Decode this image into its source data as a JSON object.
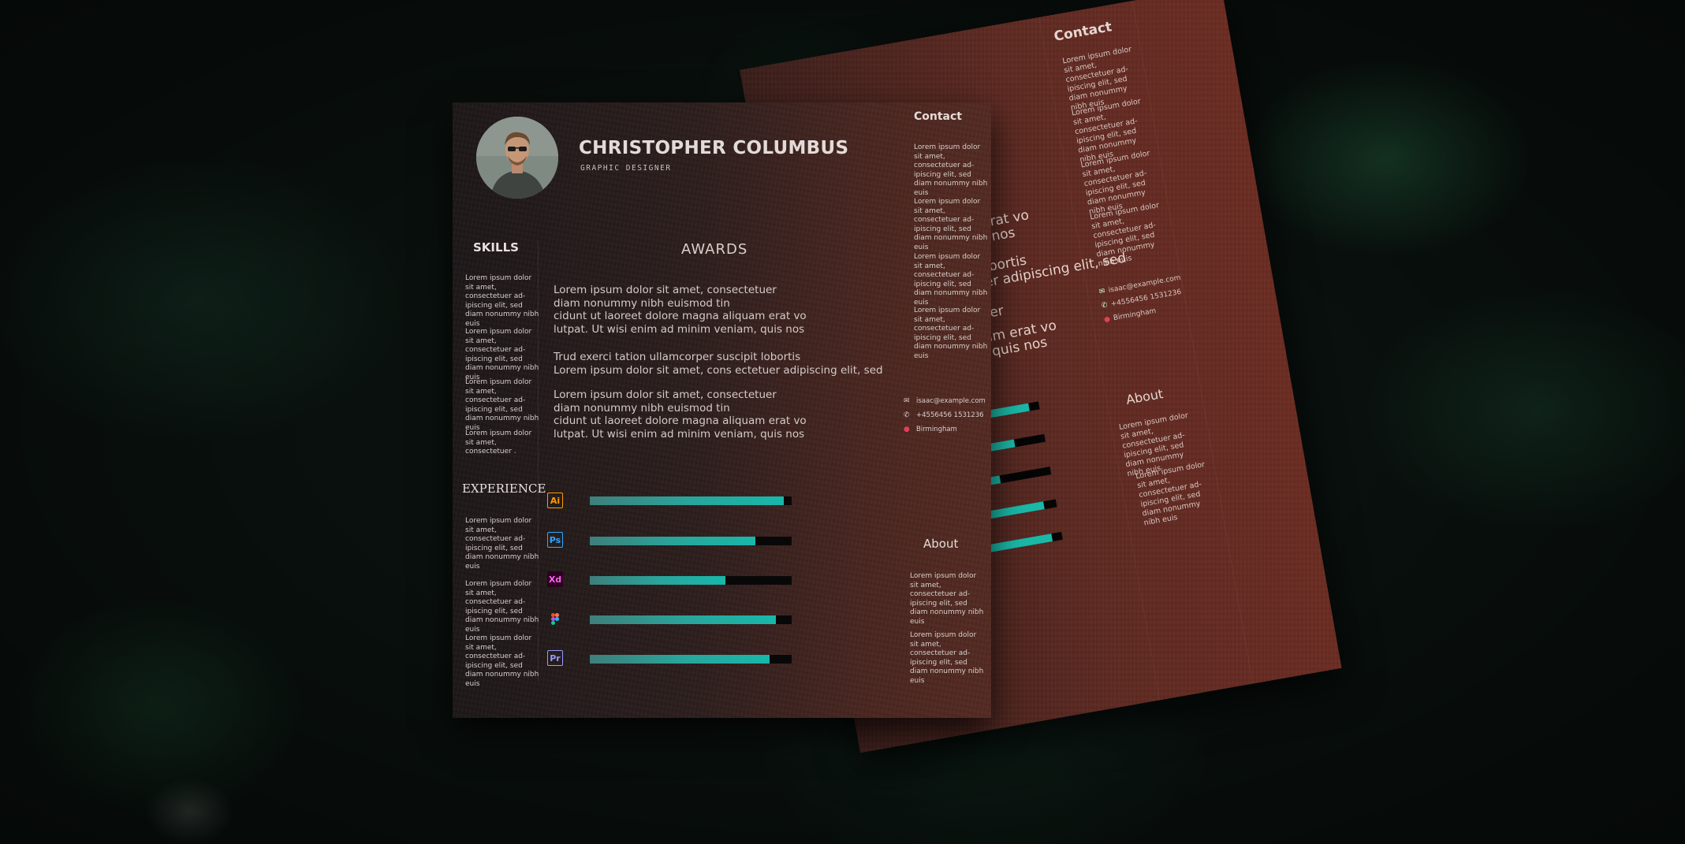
{
  "resume": {
    "name": "CHRISTOPHER COLUMBUS",
    "role": "GRAPHIC DESIGNER",
    "skills_title": "SKILLS",
    "skills_items": [
      "Lorem ipsum dolor sit amet, consectetuer ad-ipiscing elit, sed diam nonummy nibh euis",
      "Lorem ipsum dolor sit amet, consectetuer ad-ipiscing elit, sed diam nonummy nibh euis",
      "Lorem ipsum dolor sit amet, consectetuer ad-ipiscing elit, sed diam nonummy nibh euis",
      "Lorem ipsum dolor sit amet, consectetuer ."
    ],
    "experience_title": "EXPERIENCE",
    "experience_items": [
      "Lorem ipsum dolor sit amet, consectetuer ad-ipiscing elit, sed diam nonummy nibh euis",
      "Lorem ipsum dolor sit amet, consectetuer ad-ipiscing elit, sed diam nonummy nibh euis",
      "Lorem ipsum dolor sit amet, consectetuer ad-ipiscing elit, sed diam nonummy nibh euis"
    ],
    "awards_title": "AWARDS",
    "awards_paragraphs": [
      "Lorem ipsum dolor sit amet, consectetuer\ndiam nonummy nibh euismod tin\ncidunt ut laoreet dolore magna aliquam erat vo\nlutpat. Ut wisi enim ad minim veniam, quis nos",
      "Trud exerci tation ullamcorper suscipit lobortis\nLorem ipsum dolor sit amet, cons ectetuer adipiscing elit, sed",
      "Lorem ipsum dolor sit amet, consectetuer\ndiam nonummy nibh euismod tin\ncidunt ut laoreet dolore magna aliquam erat vo\nlutpat. Ut wisi enim ad minim veniam, quis nos"
    ],
    "contact_title": "Contact",
    "contact_items": [
      "Lorem ipsum dolor sit amet, consectetuer ad-ipiscing elit, sed diam nonummy nibh euis",
      "Lorem ipsum dolor sit amet, consectetuer ad-ipiscing elit, sed diam nonummy nibh euis",
      "Lorem ipsum dolor sit amet, consectetuer ad-ipiscing elit, sed diam nonummy nibh euis",
      "Lorem ipsum dolor sit amet, consectetuer ad-ipiscing elit, sed diam nonummy nibh euis"
    ],
    "email": "isaac@example.com",
    "phone": "+4556456 1531236",
    "location": "Birmingham",
    "about_title": "About",
    "about_items": [
      "Lorem ipsum dolor sit amet, consectetuer ad-ipiscing elit, sed diam nonummy nibh euis",
      "Lorem ipsum dolor sit amet, consectetuer ad-ipiscing elit, sed diam nonummy nibh euis"
    ],
    "software": [
      {
        "icon": "illustrator-icon",
        "label": "Ai",
        "color": "#ff9a00",
        "level": 0.96
      },
      {
        "icon": "photoshop-icon",
        "label": "Ps",
        "color": "#31a8ff",
        "level": 0.82
      },
      {
        "icon": "xd-icon",
        "label": "Xd",
        "color": "#ff61f6",
        "level": 0.67
      },
      {
        "icon": "figma-icon",
        "label": "",
        "color": "#f24e1e",
        "level": 0.92
      },
      {
        "icon": "premiere-icon",
        "label": "Pr",
        "color": "#9999ff",
        "level": 0.89
      }
    ]
  },
  "back_page": {
    "contact_title": "Contact",
    "contact_items": [
      "Lorem ipsum dolor sit amet, consectetuer ad-ipiscing elit, sed diam nonummy nibh euis",
      "Lorem ipsum dolor sit amet, consectetuer ad-ipiscing elit, sed diam nonummy nibh euis",
      "Lorem ipsum dolor sit amet, consectetuer ad-ipiscing elit, sed diam nonummy nibh euis",
      "Lorem ipsum dolor sit amet, consectetuer ad-ipiscing elit, sed diam nonummy nibh euis"
    ],
    "email": "isaac@example.com",
    "phone": "+4556456 1531236",
    "location": "Birmingham",
    "about_title": "About",
    "about_items": [
      "Lorem ipsum dolor sit amet, consectetuer ad-ipiscing elit, sed diam nonummy nibh euis",
      "Lorem ipsum dolor sit amet, consectetuer ad-ipiscing elit, sed diam nonummy nibh euis"
    ],
    "text_fragments": [
      "er",
      "iquam erat vo",
      "m, quis nos",
      "pit lobortis",
      "ectetuer adipiscing elit, sed",
      "ctetuer",
      "aliquam erat vo",
      "niam, quis nos"
    ],
    "bar_levels": [
      0.9,
      0.7,
      0.5,
      0.88,
      0.9
    ]
  }
}
